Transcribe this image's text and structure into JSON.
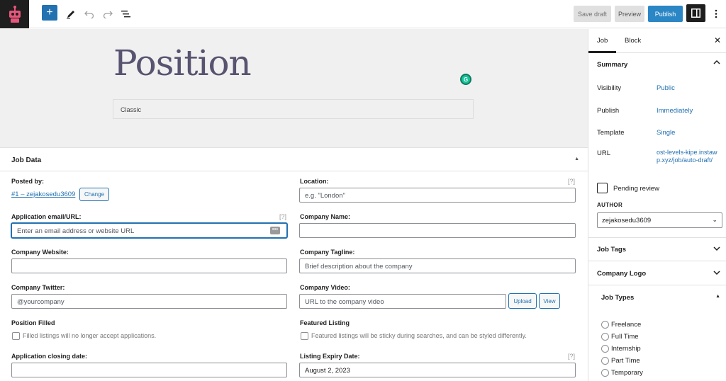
{
  "toolbar": {
    "add_icon": "plus-icon",
    "save_draft": "Save draft",
    "preview": "Preview",
    "publish": "Publish"
  },
  "editor": {
    "title": "Position",
    "classic_block": "Classic"
  },
  "job_data": {
    "title": "Job Data",
    "help": "[?]",
    "posted_by": {
      "label": "Posted by:",
      "user": "#1 – zejakosedu3609",
      "change": "Change"
    },
    "location": {
      "label": "Location:",
      "placeholder": "e.g. \"London\""
    },
    "application": {
      "label": "Application email/URL:",
      "placeholder": "Enter an email address or website URL"
    },
    "company_name": {
      "label": "Company Name:",
      "value": ""
    },
    "company_website": {
      "label": "Company Website:",
      "value": ""
    },
    "company_tagline": {
      "label": "Company Tagline:",
      "placeholder": "Brief description about the company"
    },
    "company_twitter": {
      "label": "Company Twitter:",
      "placeholder": "@yourcompany"
    },
    "company_video": {
      "label": "Company Video:",
      "placeholder": "URL to the company video",
      "upload": "Upload",
      "view": "View"
    },
    "position_filled": {
      "label": "Position Filled",
      "desc": "Filled listings will no longer accept applications."
    },
    "featured_listing": {
      "label": "Featured Listing",
      "desc": "Featured listings will be sticky during searches, and can be styled differently."
    },
    "closing_date": {
      "label": "Application closing date:",
      "value": ""
    },
    "expiry_date": {
      "label": "Listing Expiry Date:",
      "value": "August 2, 2023"
    }
  },
  "sidebar": {
    "tabs": [
      "Job",
      "Block"
    ],
    "active_tab": "Job",
    "summary": {
      "title": "Summary",
      "rows": [
        {
          "label": "Visibility",
          "value": "Public"
        },
        {
          "label": "Publish",
          "value": "Immediately"
        },
        {
          "label": "Template",
          "value": "Single"
        },
        {
          "label": "URL",
          "value": "ost-levels-kipe.instawp.xyz/job/auto-draft/"
        }
      ],
      "pending_review": "Pending review",
      "author_label": "AUTHOR",
      "author_value": "zejakosedu3609"
    },
    "job_tags": "Job Tags",
    "company_logo": "Company Logo",
    "job_types": {
      "title": "Job Types",
      "options": [
        "Freelance",
        "Full Time",
        "Internship",
        "Part Time",
        "Temporary"
      ]
    }
  }
}
